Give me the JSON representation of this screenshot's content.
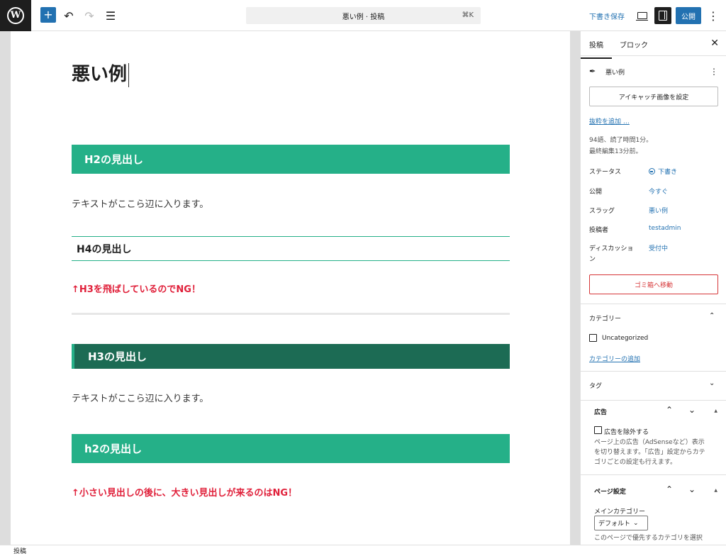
{
  "toolbar": {
    "logo": "W",
    "add_icon": "+",
    "undo_icon": "↶",
    "redo_icon": "↷",
    "outline_icon": "☰",
    "command_title": "悪い例 · 投稿",
    "command_shortcut": "⌘K",
    "save_draft": "下書き保存",
    "publish": "公開",
    "more_icon": "⋮"
  },
  "editor": {
    "title": "悪い例",
    "blocks": {
      "h2_first": "H2の見出し",
      "para_1": "テキストがここら辺に入ります。",
      "h4": "H4の見出し",
      "ng_1": "↑H3を飛ばしているのでNG！",
      "h3": "H3の見出し",
      "para_2": "テキストがここら辺に入ります。",
      "h2_second": "h2の見出し",
      "ng_2": "↑小さい見出しの後に、大きい見出しが来るのはNG！"
    }
  },
  "sidebar": {
    "tabs": [
      "投稿",
      "ブロック"
    ],
    "close_icon": "✕",
    "post_title": "悪い例",
    "post_more_icon": "⋮",
    "featured_image_button": "アイキャッチ画像を設定",
    "excerpt_link": "抜粋を追加 …",
    "stats_line1": "94語、読了時間1分。",
    "stats_line2": "最終編集13分前。",
    "rows": [
      {
        "label": "ステータス",
        "value": "下書き"
      },
      {
        "label": "公開",
        "value": "今すぐ"
      },
      {
        "label": "スラッグ",
        "value": "悪い例"
      },
      {
        "label": "投稿者",
        "value": "testadmin"
      },
      {
        "label": "ディスカッショ",
        "label2": "ン",
        "value": "受付中"
      }
    ],
    "trash_button": "ゴミ箱へ移動",
    "categories": {
      "title": "カテゴリー",
      "item": "Uncategorized",
      "add_link": "カテゴリーの追加"
    },
    "tags": {
      "title": "タグ"
    },
    "ads": {
      "title": "広告",
      "checkbox_label": "広告を除外する",
      "desc_line1": "ページ上の広告（AdSenseなど）表示",
      "desc_line2": "を切り替えます。「広告」設定からカテ",
      "desc_line3": "ゴリごとの設定も行えます。"
    },
    "page_settings": {
      "title": "ページ設定",
      "main_category_label": "メインカテゴリー",
      "select_value": "デフォルト",
      "desc_line1": "このページで優先するカテゴリを選択"
    }
  },
  "footer": {
    "breadcrumb": "投稿"
  }
}
